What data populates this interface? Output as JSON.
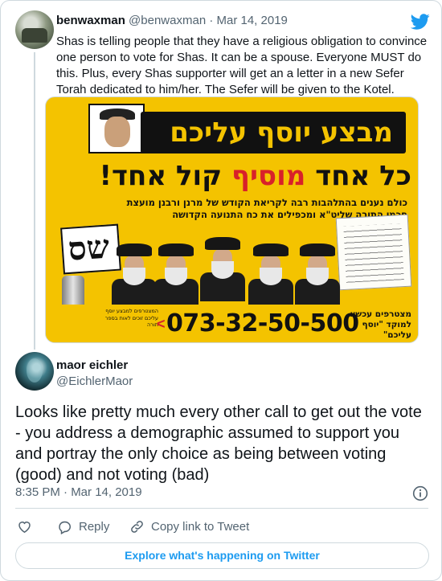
{
  "parent_tweet": {
    "name": "benwaxman",
    "handle": "@benwaxman",
    "separator": "·",
    "date": "Mar 14, 2019",
    "text": "Shas is telling people that they have a religious obligation to convince one person to vote for Shas. It can be a spouse. Everyone MUST do this. Plus, every Shas supporter will get an a letter in a new Sefer Torah dedicated to him/her. The Sefer will be given to the Kotel.",
    "image": {
      "banner_text": "מבצע יוסף עליכם",
      "headline_part1": "כל אחד ",
      "headline_highlight": "מוסיף",
      "headline_part2": " קול אחד!",
      "subtext": "כולם נענים בהתלהבות רבה לקריאת הקודש של מרנן ורבנן מועצת חכמי התורה שליט\"א ומכפילים את כח התנועה הקדושה",
      "party_logo": "שס",
      "phone": "073-32-50-500",
      "join_text": "מצטרפים עכשיו למוקד \"יוסף עליכם\"",
      "small_text": "המצטרפים למבצע יוסף עליכם זוכים לאות בספר תורה",
      "accent_color": "#f4c300",
      "highlight_color": "#d8212a"
    }
  },
  "main_tweet": {
    "name": "maor eichler",
    "handle": "@EichlerMaor",
    "text": "Looks like pretty much every other call to get out the vote - you address a demographic assumed to support you and portray the only choice as being between voting (good) and not voting (bad)",
    "time": "8:35 PM · Mar 14, 2019"
  },
  "actions": {
    "like_icon": "heart-icon",
    "reply_label": "Reply",
    "copy_link_label": "Copy link to Tweet"
  },
  "explore_label": "Explore what's happening on Twitter",
  "colors": {
    "brand_blue": "#1d9bf0",
    "secondary_text": "#536471",
    "border": "#cfd9de"
  }
}
